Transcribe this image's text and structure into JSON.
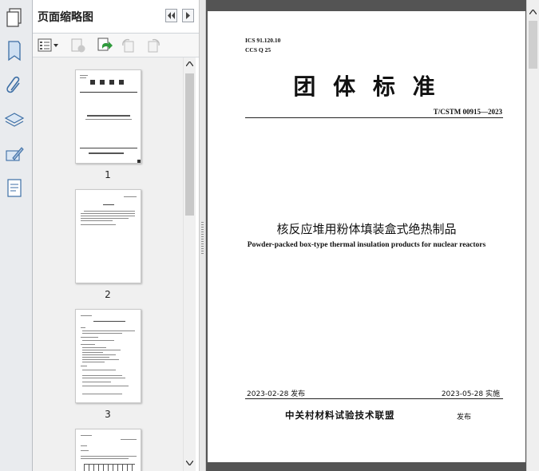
{
  "sidebar_panel": {
    "title": "页面缩略图",
    "pages": [
      {
        "number": "1"
      },
      {
        "number": "2"
      },
      {
        "number": "3"
      }
    ]
  },
  "document": {
    "ics": "ICS 91.120.10",
    "ccs": "CCS Q 25",
    "main_title": "团 体 标 准",
    "standard_code": "T/CSTM 00915—2023",
    "title_cn": "核反应堆用粉体填装盒式绝热制品",
    "title_en": "Powder-packed box-type thermal insulation products for nuclear reactors",
    "publish_date": "2023-02-28 发布",
    "implement_date": "2023-05-28 实施",
    "publisher": "中关村材料试验技术联盟",
    "publish_label": "发布"
  },
  "colors": {
    "background_dark": "#545454",
    "strip": "#e9ebee",
    "icon_blue": "#3c6ea5"
  }
}
